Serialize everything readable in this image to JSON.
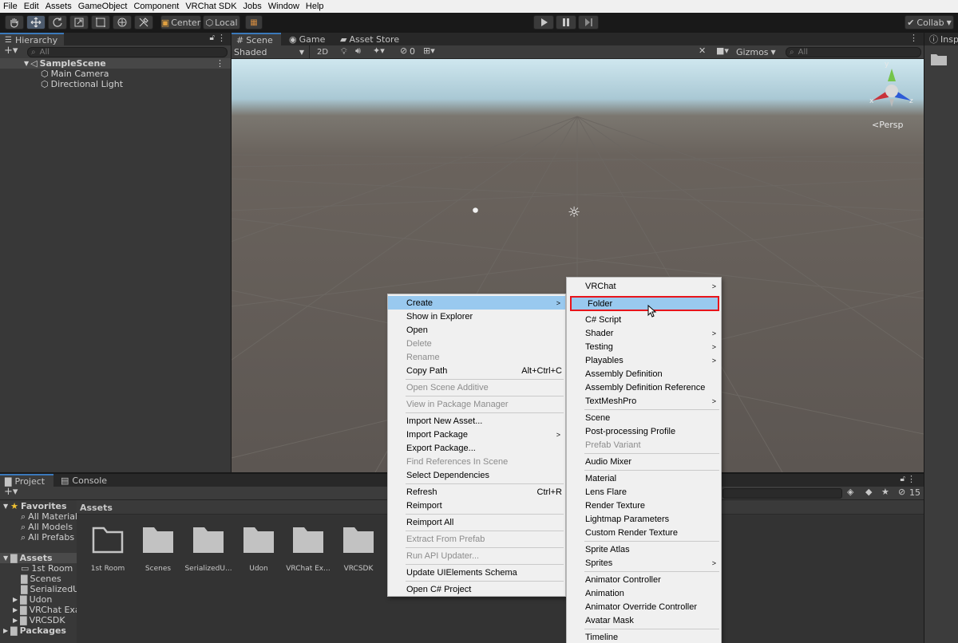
{
  "menu": [
    "File",
    "Edit",
    "Assets",
    "GameObject",
    "Component",
    "VRChat SDK",
    "Jobs",
    "Window",
    "Help"
  ],
  "toolbar": {
    "center": "Center",
    "local": "Local",
    "collab": "Collab"
  },
  "hierarchy": {
    "tab": "Hierarchy",
    "search_placeholder": "All",
    "scene": "SampleScene",
    "items": [
      "Main Camera",
      "Directional Light"
    ]
  },
  "scene": {
    "tabs": [
      "Scene",
      "Game",
      "Asset Store"
    ],
    "shading": "Shaded",
    "mode_2d": "2D",
    "hidden_count": "0",
    "gizmos": "Gizmos",
    "search_placeholder": "All",
    "persp": "Persp",
    "axis_x": "x",
    "axis_y": "y",
    "axis_z": "z"
  },
  "inspector": {
    "tab": "Inspe"
  },
  "project": {
    "tabs": [
      "Project",
      "Console"
    ],
    "favorites_label": "Favorites",
    "favorites": [
      "All Material",
      "All Models",
      "All Prefabs"
    ],
    "assets_label": "Assets",
    "assets_children": [
      "1st Room",
      "Scenes",
      "SerializedU",
      "Udon",
      "VRChat Exa",
      "VRCSDK"
    ],
    "packages_label": "Packages",
    "breadcrumb": "Assets",
    "folders": [
      "1st Room",
      "Scenes",
      "SerializedU...",
      "Udon",
      "VRChat Ex...",
      "VRCSDK"
    ],
    "hidden_count": "15"
  },
  "context_menu": {
    "items": [
      {
        "label": "Create",
        "arrow": ">",
        "highlighted": true
      },
      {
        "label": "Show in Explorer"
      },
      {
        "label": "Open"
      },
      {
        "label": "Delete",
        "disabled": true
      },
      {
        "label": "Rename",
        "disabled": true
      },
      {
        "label": "Copy Path",
        "shortcut": "Alt+Ctrl+C"
      },
      {
        "label": "Open Scene Additive",
        "disabled": true
      },
      {
        "label": "View in Package Manager",
        "disabled": true
      },
      {
        "label": "Import New Asset..."
      },
      {
        "label": "Import Package",
        "arrow": ">"
      },
      {
        "label": "Export Package..."
      },
      {
        "label": "Find References In Scene",
        "disabled": true
      },
      {
        "label": "Select Dependencies"
      },
      {
        "label": "Refresh",
        "shortcut": "Ctrl+R"
      },
      {
        "label": "Reimport"
      },
      {
        "label": "Reimport All"
      },
      {
        "label": "Extract From Prefab",
        "disabled": true
      },
      {
        "label": "Run API Updater...",
        "disabled": true
      },
      {
        "label": "Update UIElements Schema"
      },
      {
        "label": "Open C# Project"
      }
    ]
  },
  "create_submenu": {
    "items": [
      {
        "label": "VRChat",
        "arrow": ">"
      },
      {
        "label": "Folder",
        "highlighted": true
      },
      {
        "label": "C# Script"
      },
      {
        "label": "Shader",
        "arrow": ">"
      },
      {
        "label": "Testing",
        "arrow": ">"
      },
      {
        "label": "Playables",
        "arrow": ">"
      },
      {
        "label": "Assembly Definition"
      },
      {
        "label": "Assembly Definition Reference"
      },
      {
        "label": "TextMeshPro",
        "arrow": ">"
      },
      {
        "label": "Scene"
      },
      {
        "label": "Post-processing Profile"
      },
      {
        "label": "Prefab Variant",
        "disabled": true
      },
      {
        "label": "Audio Mixer"
      },
      {
        "label": "Material"
      },
      {
        "label": "Lens Flare"
      },
      {
        "label": "Render Texture"
      },
      {
        "label": "Lightmap Parameters"
      },
      {
        "label": "Custom Render Texture"
      },
      {
        "label": "Sprite Atlas"
      },
      {
        "label": "Sprites",
        "arrow": ">"
      },
      {
        "label": "Animator Controller"
      },
      {
        "label": "Animation"
      },
      {
        "label": "Animator Override Controller"
      },
      {
        "label": "Avatar Mask"
      },
      {
        "label": "Timeline"
      }
    ]
  },
  "colors": {
    "highlight": "#99c9ef",
    "selection_box": "#e8141b",
    "tab_accent": "#3a79bb"
  }
}
